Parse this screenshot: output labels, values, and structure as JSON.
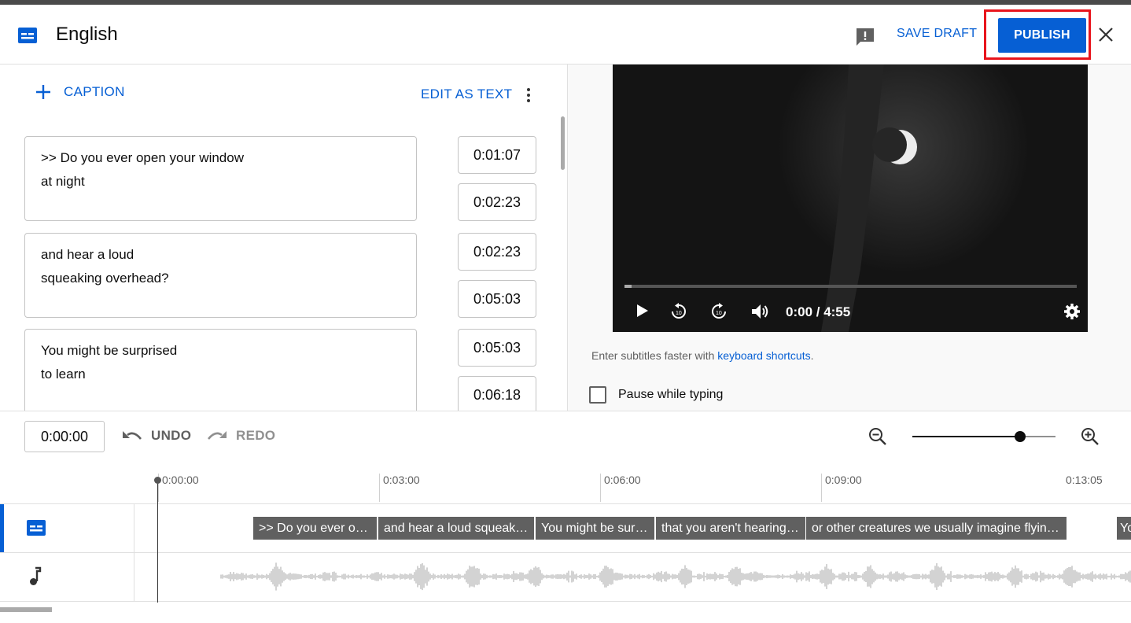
{
  "header": {
    "title": "English",
    "save_draft": "SAVE DRAFT",
    "publish": "PUBLISH"
  },
  "editor": {
    "add_caption": "CAPTION",
    "edit_as_text": "EDIT AS TEXT",
    "captions": [
      {
        "line1": ">> Do you ever open your window",
        "line2": "at night",
        "start": "0:01:07",
        "end": "0:02:23"
      },
      {
        "line1": "and hear a loud",
        "line2": "squeaking overhead?",
        "start": "0:02:23",
        "end": "0:05:03"
      },
      {
        "line1": "You might be surprised",
        "line2": "to learn",
        "start": "0:05:03",
        "end": "0:06:18"
      }
    ]
  },
  "player": {
    "time": "0:00 / 4:55",
    "progress_fraction": 0.016,
    "hint_prefix": "Enter subtitles faster with ",
    "hint_link": "keyboard shortcuts",
    "hint_suffix": ".",
    "pause_label": "Pause while typing",
    "pause_checked": false
  },
  "timeline": {
    "current_time": "0:00:00",
    "undo": "UNDO",
    "redo": "REDO",
    "zoom_level": 0.75,
    "ruler": [
      "0:00:00",
      "0:03:00",
      "0:06:00",
      "0:09:00",
      "0:13:05"
    ],
    "segments": [
      ">> Do you ever op…",
      "and hear a loud squeaki…",
      "You might be sur…",
      "that you aren't hearing …",
      "or other creatures we usually imagine flyin…",
      "Yo"
    ]
  },
  "colors": {
    "accent": "#065fd4",
    "highlight": "#e8141c",
    "segment": "#606060"
  }
}
